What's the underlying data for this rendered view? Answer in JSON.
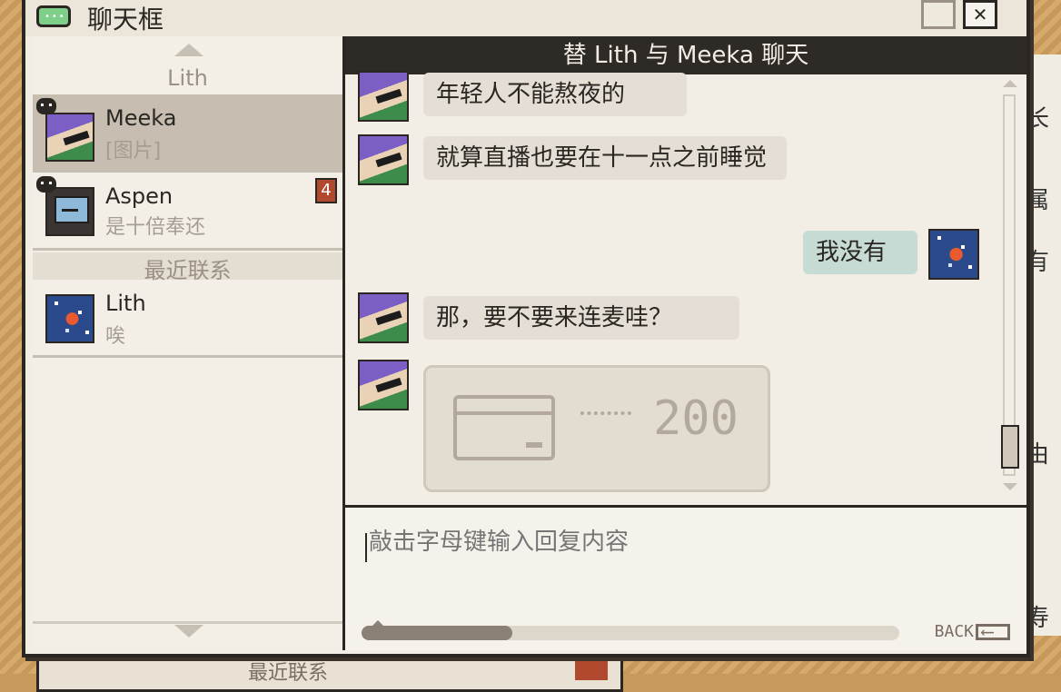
{
  "window": {
    "title": "聊天框"
  },
  "sidebar": {
    "section_pinned": "Lith",
    "contacts": [
      {
        "name": "Meeka",
        "preview": "[图片]",
        "avatar": "purple-hair-sunglasses"
      },
      {
        "name": "Aspen",
        "preview": "是十倍奉还",
        "avatar": "retro-computer",
        "unread": "4"
      }
    ],
    "section_recent": "最近联系",
    "recent": [
      {
        "name": "Lith",
        "preview": "唉",
        "avatar": "goldfish"
      }
    ]
  },
  "chat": {
    "header": "替 Lith 与 Meeka 聊天",
    "messages": [
      {
        "from": "Meeka",
        "text": "年轻人不能熬夜的"
      },
      {
        "from": "Meeka",
        "text": "就算直播也要在十一点之前睡觉"
      },
      {
        "from": "Lith",
        "text": "我没有"
      },
      {
        "from": "Meeka",
        "text": "那，要不要来连麦哇？"
      },
      {
        "from": "Meeka",
        "type": "transfer-card",
        "amount": "200"
      }
    ],
    "input_placeholder": "敲击字母键输入回复内容",
    "progress": 0.28,
    "back_label": "BACK"
  },
  "background": {
    "right_chars": [
      "长",
      "属",
      "有",
      "由",
      "寿"
    ],
    "bottom_text": "最近联系"
  },
  "colors": {
    "accent_dark": "#2e2a26",
    "badge": "#b0492e",
    "mine_bubble": "#c5dbd4",
    "bubble": "#e4ded4"
  }
}
